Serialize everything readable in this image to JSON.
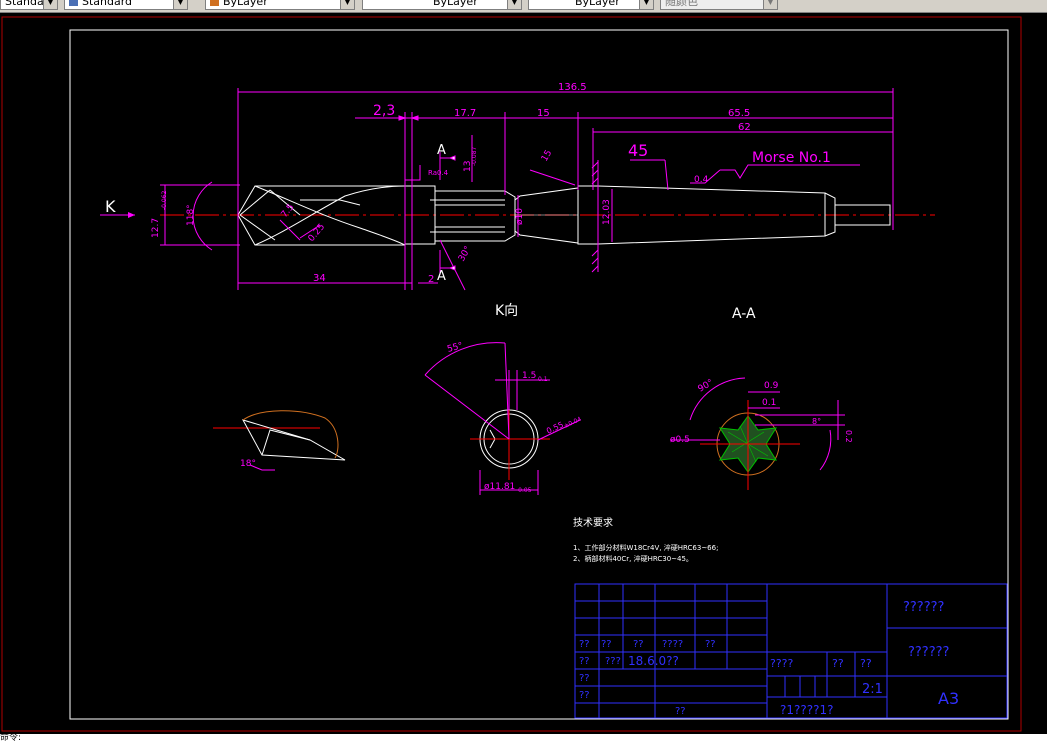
{
  "toolbar": {
    "style_combo": "Standard",
    "layer_combo": "ByLayer",
    "linetype_combo": "ByLayer",
    "lineweight_combo": "ByLayer",
    "plotstyle_combo": "随颜色"
  },
  "drawing": {
    "dims": {
      "d136": "136.5",
      "d2_3": "2,3",
      "d17_7": "17.7",
      "d15": "15",
      "d65_5": "65.5",
      "d62": "62",
      "d45": "45",
      "d34": "34",
      "d2": "2",
      "dia12_7": "12.7",
      "dia12_7_tol": "-0.062",
      "ang118": "118°",
      "d7_5": "7.5",
      "d0_25": "0.25",
      "d13": "13",
      "d13_tol": "-0.087",
      "d10": "ø10",
      "d12_03": "12.03",
      "d0_4": "0.4",
      "ang30": "30°",
      "ang15": "15",
      "ang55": "55°",
      "d1_5": "1.5",
      "d1_5_tol": "0.1",
      "d0_55": "0.55",
      "d0_55_tol": "±0.04",
      "d11_81": "ø11.81",
      "d11_81_tol": "-0.05",
      "ang18": "18°",
      "ang90": "90°",
      "d0_9": "0.9",
      "d0_1": "0.1",
      "d_phi0_5": "ø0.5",
      "ang8": "8°",
      "d02": "0.2"
    },
    "labels": {
      "k_arrow": "K",
      "section_a_top": "A",
      "section_a_bottom": "A",
      "morse": "Morse No.1",
      "k_view": "K向",
      "aa_view": "A-A",
      "roughness_a": "Ra0.4",
      "tol_frame": "13"
    },
    "tech": {
      "heading": "技术要求",
      "line1": "1、工作部分材料W18Cr4V, 淬硬HRC63~66;",
      "line2": "2、柄部材料40Cr, 淬硬HRC30~45。"
    },
    "title_block": {
      "q1": "??",
      "q2": "??",
      "q3": "??",
      "q4": "????",
      "q5": "??",
      "q6": "??",
      "q7": "???",
      "date": "18.6.0??",
      "q8": "??",
      "q9": "??",
      "q10": "??",
      "q11": "????",
      "q12": "??",
      "q13": "??",
      "scale": "2:1",
      "name": "??????",
      "material": "??????",
      "code": "??????",
      "sheet": "?1????1?",
      "size": "A3"
    }
  },
  "cmdline": {
    "text": "命令:"
  },
  "colors": {
    "magenta": "#ff00ff",
    "white": "#ffffff",
    "red": "#ff0000",
    "blue": "#0000ff",
    "border_red": "#b00000"
  }
}
